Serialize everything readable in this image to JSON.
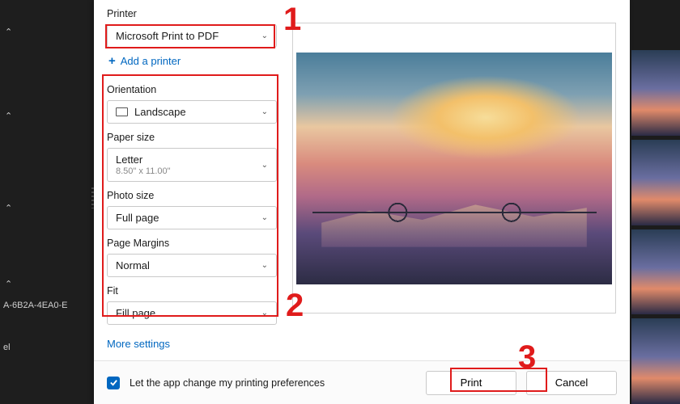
{
  "background": {
    "sidebar_partial_text": "A-6B2A-4EA0-E",
    "sidebar_item": "el"
  },
  "printer": {
    "label": "Printer",
    "value": "Microsoft Print to PDF",
    "add_link": "Add a printer"
  },
  "orientation": {
    "label": "Orientation",
    "value": "Landscape"
  },
  "paper_size": {
    "label": "Paper size",
    "value": "Letter",
    "sub": "8.50\" x 11.00\""
  },
  "photo_size": {
    "label": "Photo size",
    "value": "Full page"
  },
  "page_margins": {
    "label": "Page Margins",
    "value": "Normal"
  },
  "fit": {
    "label": "Fit",
    "value": "Fill page"
  },
  "more_settings": "More settings",
  "footer": {
    "checkbox_label": "Let the app change my printing preferences",
    "checkbox_checked": true,
    "print": "Print",
    "cancel": "Cancel"
  },
  "annotations": {
    "n1": "1",
    "n2": "2",
    "n3": "3"
  }
}
